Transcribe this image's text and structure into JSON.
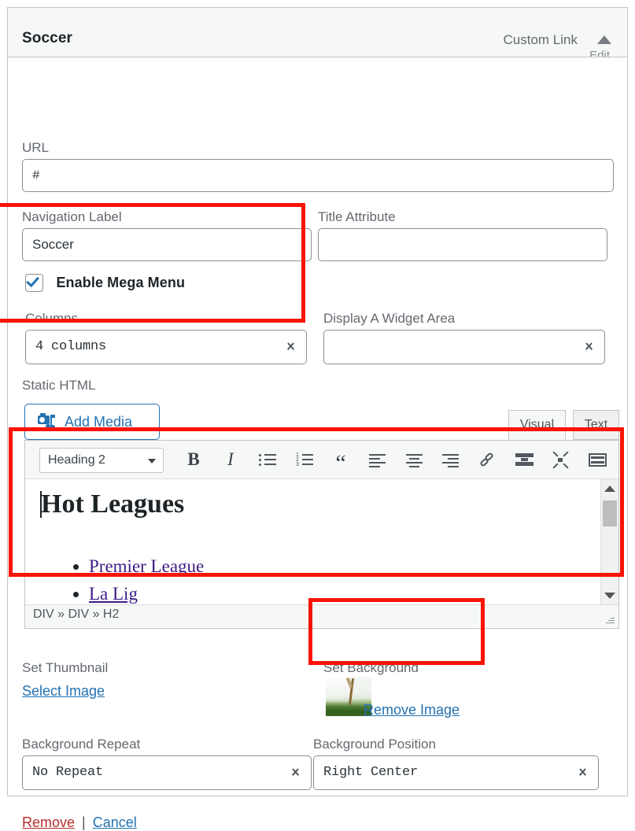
{
  "header": {
    "title": "Soccer",
    "type": "Custom Link",
    "edit_clipped": "Edit",
    "toggle_icon": "chevron-up-icon"
  },
  "fields": {
    "url": {
      "label": "URL",
      "value": "#"
    },
    "navigation_label": {
      "label": "Navigation Label",
      "value": "Soccer"
    },
    "title_attribute": {
      "label": "Title Attribute",
      "value": ""
    },
    "enable_mega_menu": {
      "label": "Enable Mega Menu",
      "checked": true
    },
    "columns": {
      "label": "Columns",
      "value": "4 columns"
    },
    "widget_area": {
      "label": "Display A Widget Area",
      "value": ""
    },
    "static_html": {
      "label": "Static HTML"
    },
    "set_thumbnail": {
      "label": "Set Thumbnail",
      "link": "Select Image"
    },
    "set_background": {
      "label": "Set Background",
      "link": "Remove Image",
      "thumbnail_icon": "background-thumbnail"
    },
    "background_repeat": {
      "label": "Background Repeat",
      "value": "No Repeat"
    },
    "background_position": {
      "label": "Background Position",
      "value": "Right Center"
    }
  },
  "editor": {
    "add_media": "Add Media",
    "add_media_icon": "add-media-icon",
    "tabs": [
      {
        "label": "Visual",
        "active": true
      },
      {
        "label": "Text",
        "active": false
      }
    ],
    "format_select": "Heading 2",
    "toolbar": [
      {
        "name": "bold-icon",
        "glyph": "B"
      },
      {
        "name": "italic-icon",
        "glyph": "I"
      },
      {
        "name": "bulleted-list-icon",
        "glyph": ""
      },
      {
        "name": "numbered-list-icon",
        "glyph": ""
      },
      {
        "name": "blockquote-icon",
        "glyph": "“"
      },
      {
        "name": "align-left-icon",
        "glyph": ""
      },
      {
        "name": "align-center-icon",
        "glyph": ""
      },
      {
        "name": "align-right-icon",
        "glyph": ""
      },
      {
        "name": "insert-link-icon",
        "glyph": ""
      },
      {
        "name": "read-more-icon",
        "glyph": ""
      },
      {
        "name": "fullscreen-icon",
        "glyph": ""
      },
      {
        "name": "toolbar-toggle-icon",
        "glyph": ""
      }
    ],
    "content": {
      "heading": "Hot Leagues",
      "list_items": [
        "Premier League",
        "La Lig"
      ]
    },
    "path": "DIV » DIV » H2"
  },
  "footer": {
    "remove": "Remove",
    "separator": "|",
    "cancel": "Cancel"
  },
  "colors": {
    "annotation": "#fa1405",
    "link": "#2271b1",
    "danger": "#b32d2e",
    "visited_link": "#3b1a86"
  }
}
